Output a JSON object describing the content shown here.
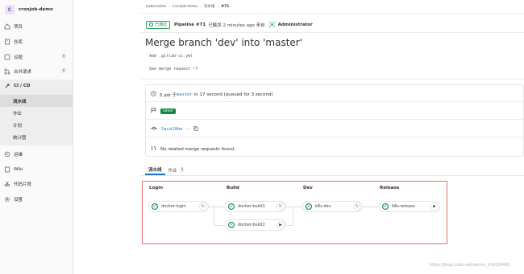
{
  "sidebar": {
    "project_avatar": "C",
    "project_name": "cronjob-demo",
    "items": [
      {
        "label": "项目",
        "icon": "project-icon"
      },
      {
        "label": "仓库",
        "icon": "repository-icon"
      },
      {
        "label": "议题",
        "icon": "issues-icon",
        "count": "0"
      },
      {
        "label": "合并请求",
        "icon": "merge-request-icon",
        "count": "0"
      }
    ],
    "cicd": {
      "label": "CI / CD",
      "icon": "rocket-icon",
      "sub_items": [
        "流水线",
        "作业",
        "计划",
        "统计图"
      ],
      "active": "流水线"
    },
    "items_after": [
      {
        "label": "运维",
        "icon": "operations-icon"
      },
      {
        "label": "Wiki",
        "icon": "book-icon"
      },
      {
        "label": "代码片段",
        "icon": "snippet-icon"
      },
      {
        "label": "设置",
        "icon": "gear-icon"
      }
    ]
  },
  "breadcrumb": [
    "kubernetes",
    "cronjob-demo",
    "流水线",
    "#71"
  ],
  "header": {
    "status": "已通过",
    "pipeline_id": "Pipeline #71",
    "meta": "已触发 2 minutes ago 来自",
    "user": "Administrator"
  },
  "commit": {
    "title": "Merge branch 'dev' into 'master'",
    "line1": "Add .gitlab-ci.yml",
    "line2": "See merge request !7"
  },
  "info": {
    "jobs_prefix": "5 job 于",
    "branch": "master",
    "jobs_suffix": "in 17 second (queued for 3 second)",
    "tag": "latest",
    "commit_sha": "5aca10be",
    "more": "···",
    "no_mr": "No related merge requests found."
  },
  "tabs": [
    {
      "label": "流水线"
    },
    {
      "label": "作业",
      "count": "5"
    }
  ],
  "pipeline": {
    "stages": [
      {
        "name": "Login",
        "jobs": [
          {
            "name": "docker-login",
            "action": "retry"
          }
        ]
      },
      {
        "name": "Build",
        "jobs": [
          {
            "name": "docker-build1",
            "action": "retry"
          },
          {
            "name": "docker-build2",
            "action": "play"
          }
        ]
      },
      {
        "name": "Dev",
        "jobs": [
          {
            "name": "k8s-dev",
            "action": "retry"
          }
        ]
      },
      {
        "name": "Release",
        "jobs": [
          {
            "name": "k8s-release",
            "action": "play"
          }
        ]
      }
    ]
  },
  "watermark": "https://blog.csdn.net/weixin_41918498/..."
}
